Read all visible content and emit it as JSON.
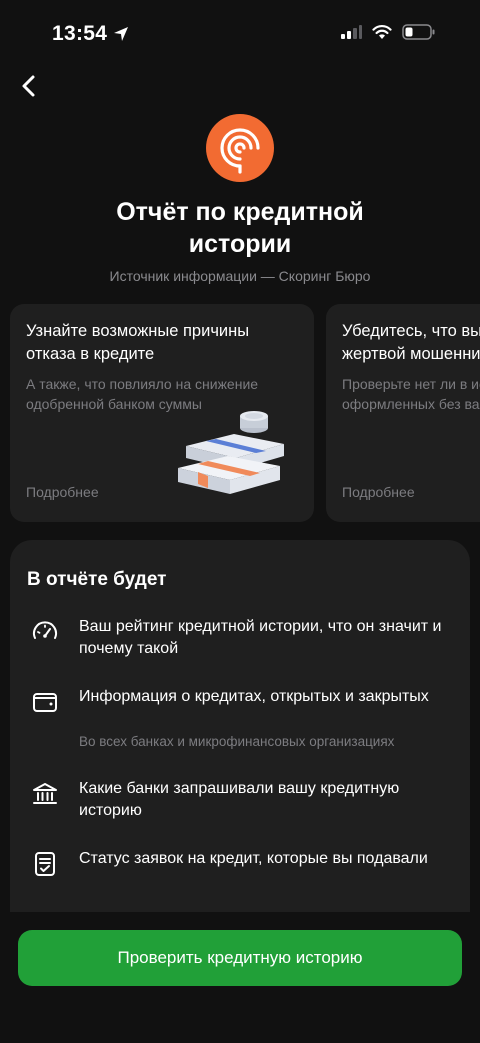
{
  "status_bar": {
    "time": "13:54"
  },
  "header": {
    "title_line1": "Отчёт по кредитной",
    "title_line2": "истории",
    "subtitle": "Источник информации — Скоринг Бюро"
  },
  "cards": [
    {
      "title": "Узнайте возможные причины отказа в кредите",
      "description": "А также, что повлияло на снижение одобренной банком суммы",
      "more": "Подробнее"
    },
    {
      "title": "Убедитесь, что вы не стали жертвой мошенников",
      "description": "Проверьте нет ли в истории кредитов, оформленных без вас",
      "more": "Подробнее"
    }
  ],
  "report": {
    "title": "В отчёте будет",
    "items": [
      {
        "icon": "speedometer-icon",
        "text": "Ваш рейтинг кредитной истории, что он значит и почему такой",
        "sub": ""
      },
      {
        "icon": "wallet-icon",
        "text": "Информация о кредитах, открытых и закрытых",
        "sub": "Во всех банках и микрофинансовых организациях"
      },
      {
        "icon": "bank-icon",
        "text": "Какие банки запрашивали вашу кредитную историю",
        "sub": ""
      },
      {
        "icon": "document-check-icon",
        "text": "Статус заявок на кредит, которые вы подавали",
        "sub": ""
      }
    ]
  },
  "cta": {
    "label": "Проверить кредитную историю"
  },
  "colors": {
    "accent": "#21a038",
    "logo": "#f26b32",
    "background": "#111111",
    "card": "#1f1f1f"
  }
}
